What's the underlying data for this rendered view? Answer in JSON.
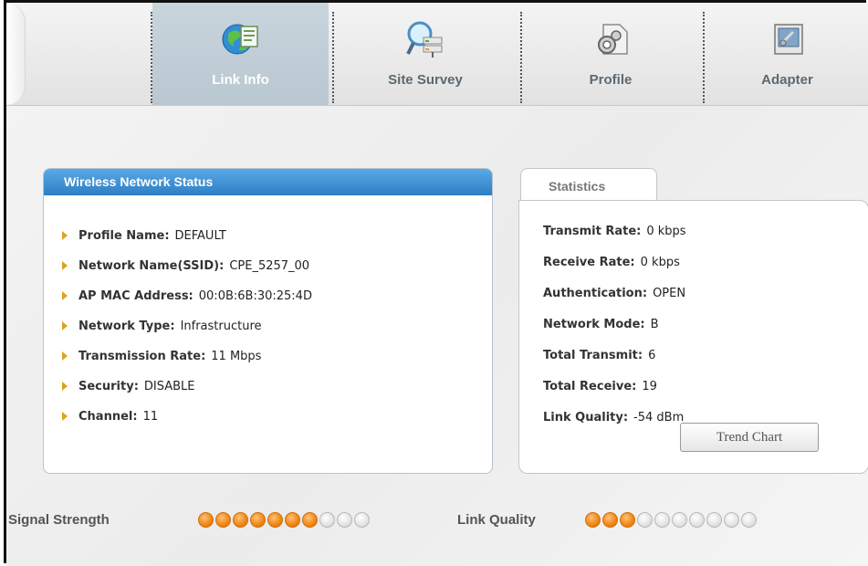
{
  "toolbar": {
    "tabs": [
      {
        "label": "Link Info",
        "icon": "globe-document-icon",
        "active": true
      },
      {
        "label": "Site Survey",
        "icon": "magnifier-network-icon",
        "active": false
      },
      {
        "label": "Profile",
        "icon": "gear-document-icon",
        "active": false
      },
      {
        "label": "Adapter",
        "icon": "adapter-card-icon",
        "active": false
      }
    ]
  },
  "wireless_status": {
    "title": "Wireless Network Status",
    "items": [
      {
        "key": "Profile Name:",
        "value": "DEFAULT"
      },
      {
        "key": "Network Name(SSID):",
        "value": "CPE_5257_00"
      },
      {
        "key": "AP MAC Address:",
        "value": "00:0B:6B:30:25:4D"
      },
      {
        "key": "Network Type:",
        "value": "Infrastructure"
      },
      {
        "key": "Transmission Rate:",
        "value": "11 Mbps"
      },
      {
        "key": "Security:",
        "value": "DISABLE"
      },
      {
        "key": "Channel:",
        "value": "11"
      }
    ]
  },
  "statistics": {
    "tab_label": "Statistics",
    "items": [
      {
        "key": "Transmit Rate:",
        "value": "0 kbps"
      },
      {
        "key": "Receive Rate:",
        "value": "0 kbps"
      },
      {
        "key": "Authentication:",
        "value": "OPEN"
      },
      {
        "key": "Network Mode:",
        "value": "B"
      },
      {
        "key": "Total Transmit:",
        "value": "6"
      },
      {
        "key": "Total Receive:",
        "value": "19"
      },
      {
        "key": "Link Quality:",
        "value": "-54 dBm"
      }
    ],
    "trend_button": "Trend Chart"
  },
  "indicators": {
    "signal_strength": {
      "label": "Signal Strength",
      "level": 7,
      "total": 10
    },
    "link_quality": {
      "label": "Link Quality",
      "level": 3,
      "total": 10
    }
  },
  "colors": {
    "header_blue": "#2d7ec4",
    "dot_on": "#f08a18",
    "dot_off": "#d9d9d9",
    "active_tab": "#c2cfd8"
  }
}
